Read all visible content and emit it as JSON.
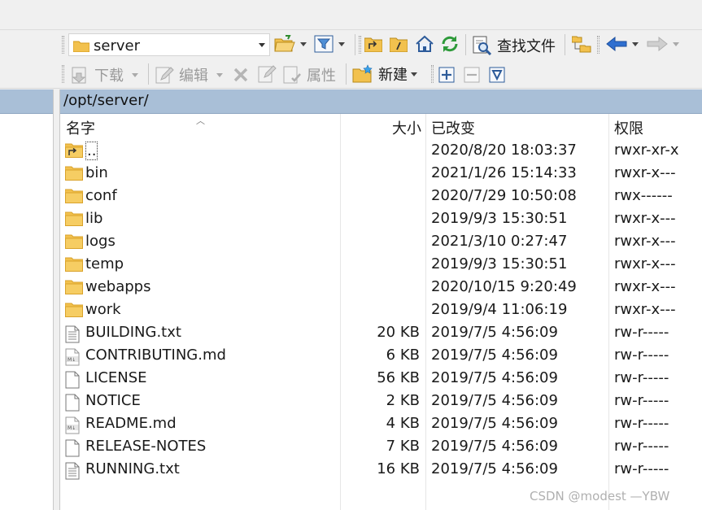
{
  "toolbar1": {
    "path_value": "server",
    "find_label": "查找文件"
  },
  "toolbar2": {
    "download_label": "下载",
    "edit_label": "编辑",
    "properties_label": "属性",
    "new_label": "新建"
  },
  "path_bar": {
    "path": "/opt/server/"
  },
  "columns": {
    "name": "名字",
    "size": "大小",
    "modified": "已改变",
    "permissions": "权限"
  },
  "files": [
    {
      "name": "..",
      "size": "",
      "modified": "2020/8/20 18:03:37",
      "perm": "rwxr-xr-x",
      "icon": "parent-folder-icon"
    },
    {
      "name": "bin",
      "size": "",
      "modified": "2021/1/26 15:14:33",
      "perm": "rwxr-x---",
      "icon": "folder-icon"
    },
    {
      "name": "conf",
      "size": "",
      "modified": "2020/7/29 10:50:08",
      "perm": "rwx------",
      "icon": "folder-icon"
    },
    {
      "name": "lib",
      "size": "",
      "modified": "2019/9/3 15:30:51",
      "perm": "rwxr-x---",
      "icon": "folder-icon"
    },
    {
      "name": "logs",
      "size": "",
      "modified": "2021/3/10 0:27:47",
      "perm": "rwxr-x---",
      "icon": "folder-icon"
    },
    {
      "name": "temp",
      "size": "",
      "modified": "2019/9/3 15:30:51",
      "perm": "rwxr-x---",
      "icon": "folder-icon"
    },
    {
      "name": "webapps",
      "size": "",
      "modified": "2020/10/15 9:20:49",
      "perm": "rwxr-x---",
      "icon": "folder-icon"
    },
    {
      "name": "work",
      "size": "",
      "modified": "2019/9/4 11:06:19",
      "perm": "rwxr-x---",
      "icon": "folder-icon"
    },
    {
      "name": "BUILDING.txt",
      "size": "20 KB",
      "modified": "2019/7/5 4:56:09",
      "perm": "rw-r-----",
      "icon": "text-file-icon"
    },
    {
      "name": "CONTRIBUTING.md",
      "size": "6 KB",
      "modified": "2019/7/5 4:56:09",
      "perm": "rw-r-----",
      "icon": "markdown-file-icon"
    },
    {
      "name": "LICENSE",
      "size": "56 KB",
      "modified": "2019/7/5 4:56:09",
      "perm": "rw-r-----",
      "icon": "blank-file-icon"
    },
    {
      "name": "NOTICE",
      "size": "2 KB",
      "modified": "2019/7/5 4:56:09",
      "perm": "rw-r-----",
      "icon": "blank-file-icon"
    },
    {
      "name": "README.md",
      "size": "4 KB",
      "modified": "2019/7/5 4:56:09",
      "perm": "rw-r-----",
      "icon": "markdown-file-icon"
    },
    {
      "name": "RELEASE-NOTES",
      "size": "7 KB",
      "modified": "2019/7/5 4:56:09",
      "perm": "rw-r-----",
      "icon": "blank-file-icon"
    },
    {
      "name": "RUNNING.txt",
      "size": "16 KB",
      "modified": "2019/7/5 4:56:09",
      "perm": "rw-r-----",
      "icon": "text-file-icon"
    }
  ],
  "watermark": "CSDN @modest —YBW",
  "colors": {
    "path_bar": "#a9bfd7",
    "folder": "#f2c14e"
  }
}
